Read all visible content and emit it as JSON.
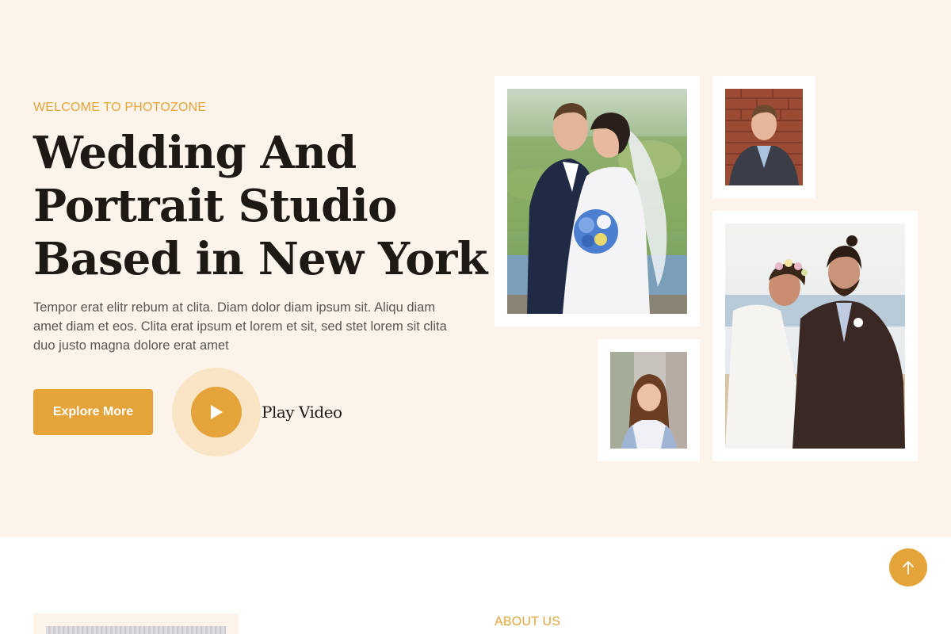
{
  "hero": {
    "eyebrow": "WELCOME TO PHOTOZONE",
    "headline_lines": [
      "Wedding And",
      "Portrait Studio",
      "Based in New York"
    ],
    "lead": "Tempor erat elitr rebum at clita. Diam dolor diam ipsum sit. Aliqu diam amet diam et eos. Clita erat ipsum et lorem et sit, sed stet lorem sit clita duo justo magna dolore erat amet",
    "explore_button": "Explore More",
    "play_video_label": "Play Video"
  },
  "gallery": {
    "photos": [
      {
        "subject": "wedding couple kissing with bouquet"
      },
      {
        "subject": "man portrait"
      },
      {
        "subject": "couple embracing outdoors"
      },
      {
        "subject": "woman portrait"
      }
    ]
  },
  "about": {
    "label": "ABOUT US"
  },
  "icons": {
    "play": "play-icon",
    "scroll_top": "arrow-up-icon"
  },
  "colors": {
    "accent": "#e5a43a",
    "hero_bg": "#fcf4eb",
    "ring": "#f9e5c5",
    "heading": "#1d1914",
    "body_text": "#5a554f"
  }
}
